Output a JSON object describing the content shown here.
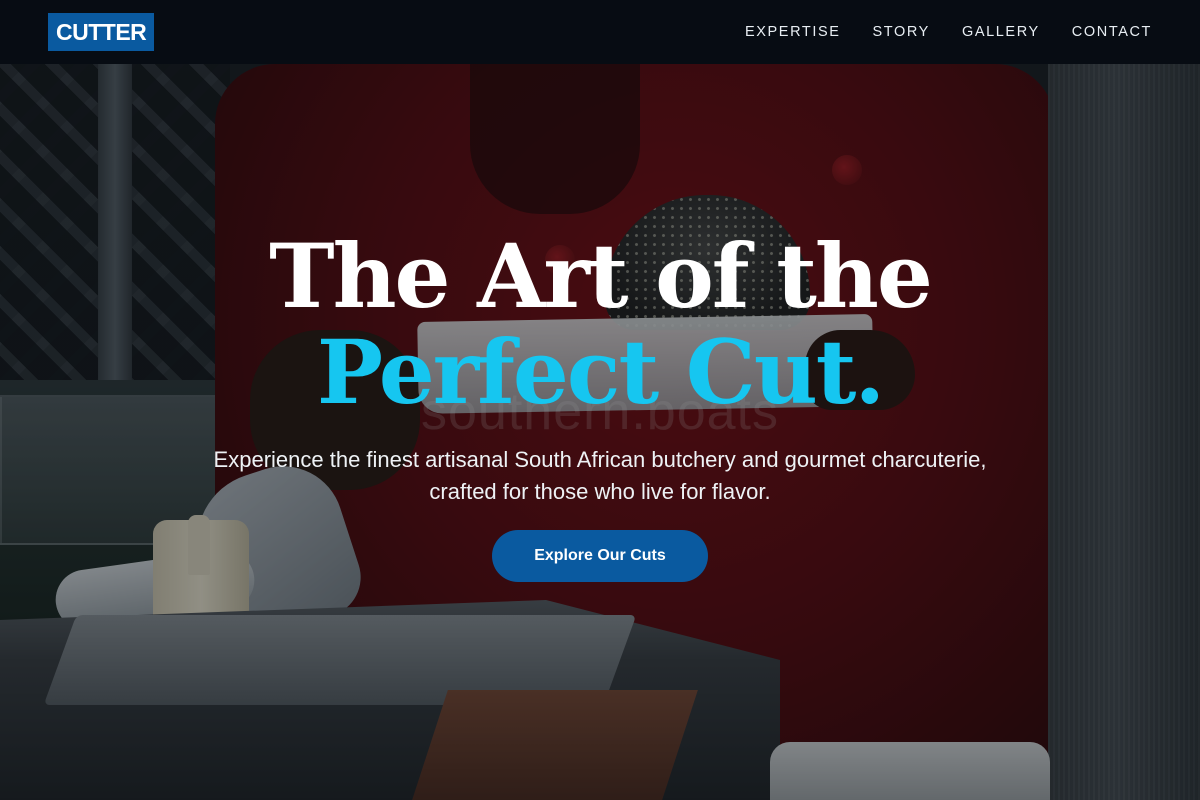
{
  "brand": {
    "logo_text": "CUTTER"
  },
  "nav": {
    "items": [
      {
        "label": "EXPERTISE"
      },
      {
        "label": "STORY"
      },
      {
        "label": "GALLERY"
      },
      {
        "label": "CONTACT"
      }
    ]
  },
  "hero": {
    "headline_line1": "The Art of the",
    "headline_line2": "Perfect Cut.",
    "subtitle": "Experience the finest artisanal South African butchery and gourmet charcuterie, crafted for those who live for flavor.",
    "cta_label": "Explore Our Cuts",
    "background_watermark": "southern.boats"
  },
  "colors": {
    "brand_blue": "#0a5aa0",
    "accent_cyan": "#16c6f0",
    "nav_background": "#060c12"
  }
}
